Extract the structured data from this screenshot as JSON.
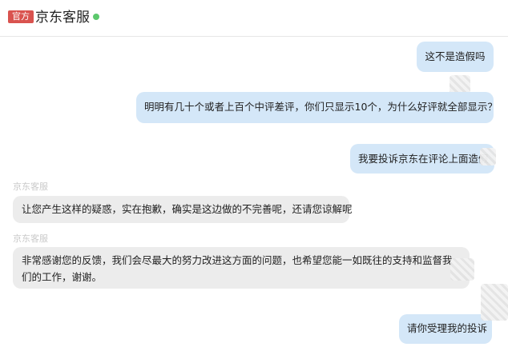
{
  "header": {
    "badge": "官方",
    "title": "京东客服",
    "status_color": "#5cc86c"
  },
  "messages": [
    {
      "side": "right",
      "text": "这不是造假吗"
    },
    {
      "side": "right",
      "text": "明明有几十个或者上百个中评差评，你们只显示10个，为什么好评就全部显示？"
    },
    {
      "side": "right",
      "text": "我要投诉京东在评论上面造假"
    },
    {
      "side": "left",
      "sender": "京东客服",
      "text": "让您产生这样的疑惑，实在抱歉，确实是这边做的不完善呢，还请您谅解呢"
    },
    {
      "side": "left",
      "sender": "京东客服",
      "text": "非常感谢您的反馈，我们会尽最大的努力改进这方面的问题，也希望您能一如既往的支持和监督我们的工作，谢谢。"
    },
    {
      "side": "right",
      "text": "请你受理我的投诉"
    }
  ]
}
